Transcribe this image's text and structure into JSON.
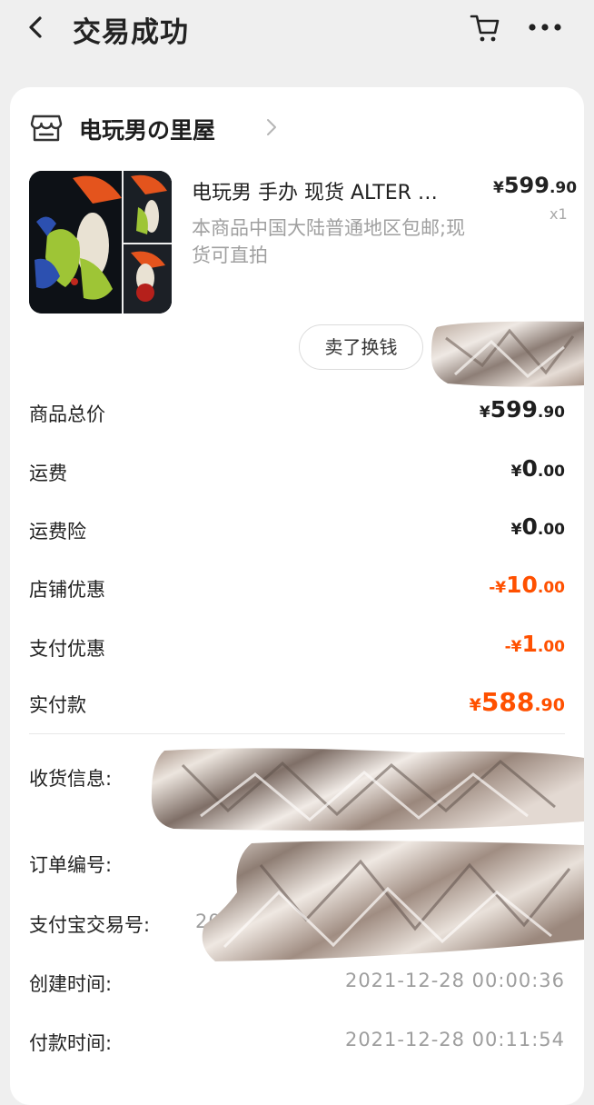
{
  "header": {
    "title": "交易成功",
    "back_icon": "back-arrow-icon",
    "cart_icon": "cart-icon",
    "more_icon": "more-icon"
  },
  "shop": {
    "name": "电玩男の里屋",
    "icon": "shop-icon"
  },
  "product": {
    "title": "电玩男 手办 现货 ALTER …",
    "description": "本商品中国大陆普通地区包邮;现货可直拍",
    "price_symbol": "¥",
    "price_int": "599",
    "price_dec": ".90",
    "quantity": "x1",
    "sell_button": "卖了换钱"
  },
  "summary": [
    {
      "label": "商品总价",
      "symbol": "¥",
      "int": "599",
      "dec": ".90"
    },
    {
      "label": "运费",
      "symbol": "¥",
      "int": "0",
      "dec": ".00"
    },
    {
      "label": "运费险",
      "symbol": "¥",
      "int": "0",
      "dec": ".00"
    },
    {
      "label": "店铺优惠",
      "symbol": "-¥",
      "int": "10",
      "dec": ".00"
    },
    {
      "label": "支付优惠",
      "symbol": "-¥",
      "int": "1",
      "dec": ".00"
    },
    {
      "label": "实付款",
      "symbol": "¥",
      "int": "588",
      "dec": ".90"
    }
  ],
  "info": [
    {
      "label": "收货信息:",
      "value": ""
    },
    {
      "label": "订单编号:",
      "value": ""
    },
    {
      "label": "支付宝交易号:",
      "value": "20"
    },
    {
      "label": "创建时间:",
      "value": "2021-12-28 00:00:36"
    },
    {
      "label": "付款时间:",
      "value": "2021-12-28 00:11:54"
    }
  ],
  "colors": {
    "accent": "#ff5000",
    "background": "#efefef",
    "card": "#ffffff",
    "muted_text": "#a0a0a0"
  }
}
